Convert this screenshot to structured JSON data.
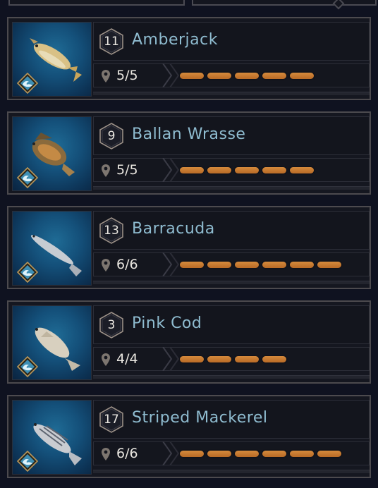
{
  "fish_list": [
    {
      "level": "11",
      "name": "Amberjack",
      "locations": "5/5",
      "progress_pips": 5,
      "fish_color": "#d9c186",
      "fish_shape": "amberjack"
    },
    {
      "level": "9",
      "name": "Ballan Wrasse",
      "locations": "5/5",
      "progress_pips": 5,
      "fish_color": "#8a6a3c",
      "fish_shape": "wrasse"
    },
    {
      "level": "13",
      "name": "Barracuda",
      "locations": "6/6",
      "progress_pips": 6,
      "fish_color": "#c7ccd2",
      "fish_shape": "barracuda"
    },
    {
      "level": "3",
      "name": "Pink Cod",
      "locations": "4/4",
      "progress_pips": 4,
      "fish_color": "#d8d0bf",
      "fish_shape": "cod"
    },
    {
      "level": "17",
      "name": "Striped Mackerel",
      "locations": "6/6",
      "progress_pips": 6,
      "fish_color": "#c9ccd1",
      "fish_shape": "mackerel"
    }
  ],
  "colors": {
    "name_text": "#8fbcd0",
    "pip": "#c97a30",
    "water_badge": "#4fa6c7",
    "card_border": "#4c4a4e"
  },
  "icons": {
    "location": "map-pin-icon",
    "water": "water-wave-icon",
    "level_frame": "hexagon-badge"
  }
}
